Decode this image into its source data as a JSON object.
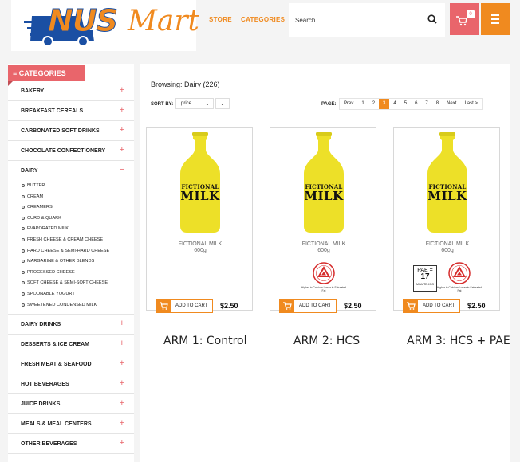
{
  "header": {
    "logo_part1": "NUS",
    "logo_part2": "Mart",
    "nav": {
      "store": "STORE",
      "categories": "CATEGORIES"
    },
    "search_placeholder": "Search",
    "cart_count": "0",
    "accent_color": "#f08a1f",
    "cart_color": "#e9656b"
  },
  "sidebar": {
    "title": "CATEGORIES",
    "items_before": [
      {
        "label": "BAKERY",
        "sign": "+"
      },
      {
        "label": "BREAKFAST CEREALS",
        "sign": "+"
      },
      {
        "label": "CARBONATED SOFT DRINKS",
        "sign": "+"
      },
      {
        "label": "CHOCOLATE CONFECTIONERY",
        "sign": "+"
      }
    ],
    "open_item": {
      "label": "DAIRY",
      "sign": "−"
    },
    "dairy_subitems": [
      "BUTTER",
      "CREAM",
      "CREAMERS",
      "CURD & QUARK",
      "EVAPORATED MILK",
      "FRESH CHEESE & CREAM CHEESE",
      "HARD CHEESE & SEMI-HARD CHEESE",
      "MARGARINE & OTHER BLENDS",
      "PROCESSED CHEESE",
      "SOFT CHEESE & SEMI-SOFT CHEESE",
      "SPOONABLE YOGURT",
      "SWEETENED CONDENSED MILK"
    ],
    "items_after": [
      {
        "label": "DAIRY DRINKS",
        "sign": "+"
      },
      {
        "label": "DESSERTS & ICE CREAM",
        "sign": "+"
      },
      {
        "label": "FRESH MEAT & SEAFOOD",
        "sign": "+"
      },
      {
        "label": "HOT BEVERAGES",
        "sign": "+"
      },
      {
        "label": "JUICE DRINKS",
        "sign": "+"
      },
      {
        "label": "MEALS & MEAL CENTERS",
        "sign": "+"
      },
      {
        "label": "OTHER BEVERAGES",
        "sign": "+"
      }
    ]
  },
  "main": {
    "browsing": "Browsing: Dairy (226)",
    "sort_label": "SORT BY:",
    "sort_value": "price",
    "page_label": "PAGE:",
    "pages": [
      "Prev",
      "1",
      "2",
      "3",
      "4",
      "5",
      "6",
      "7",
      "8",
      "Next",
      "Last >"
    ],
    "active_page": "3",
    "products": [
      {
        "bottle_line1": "FICTIONAL",
        "bottle_line2": "MILK",
        "name": "FICTIONAL MILK",
        "size": "600g",
        "add_to_cart": "ADD TO CART",
        "price": "$2.50",
        "arm": "ARM 1: Control",
        "hcs": false,
        "pae": false
      },
      {
        "bottle_line1": "FICTIONAL",
        "bottle_line2": "MILK",
        "name": "FICTIONAL MILK",
        "size": "600g",
        "add_to_cart": "ADD TO CART",
        "price": "$2.50",
        "arm": "ARM 2: HCS",
        "hcs": true,
        "hcs_caption": "Higher in Calcium Lower in Saturated Fat",
        "pae": false
      },
      {
        "bottle_line1": "FICTIONAL",
        "bottle_line2": "MILK",
        "name": "FICTIONAL MILK",
        "size": "600g",
        "add_to_cart": "ADD TO CART",
        "price": "$2.50",
        "arm": "ARM 3: HCS + PAE",
        "hcs": true,
        "hcs_caption": "Higher in Calcium Lower in Saturated Fat",
        "pae": true,
        "pae_line1": "PAE =",
        "pae_value": "17",
        "pae_line3": "MINUTE JOG"
      }
    ]
  },
  "icons": {
    "search": "search-icon",
    "cart": "cart-icon",
    "menu": "menu-icon",
    "hcs": "healthier-choice-symbol-icon"
  }
}
